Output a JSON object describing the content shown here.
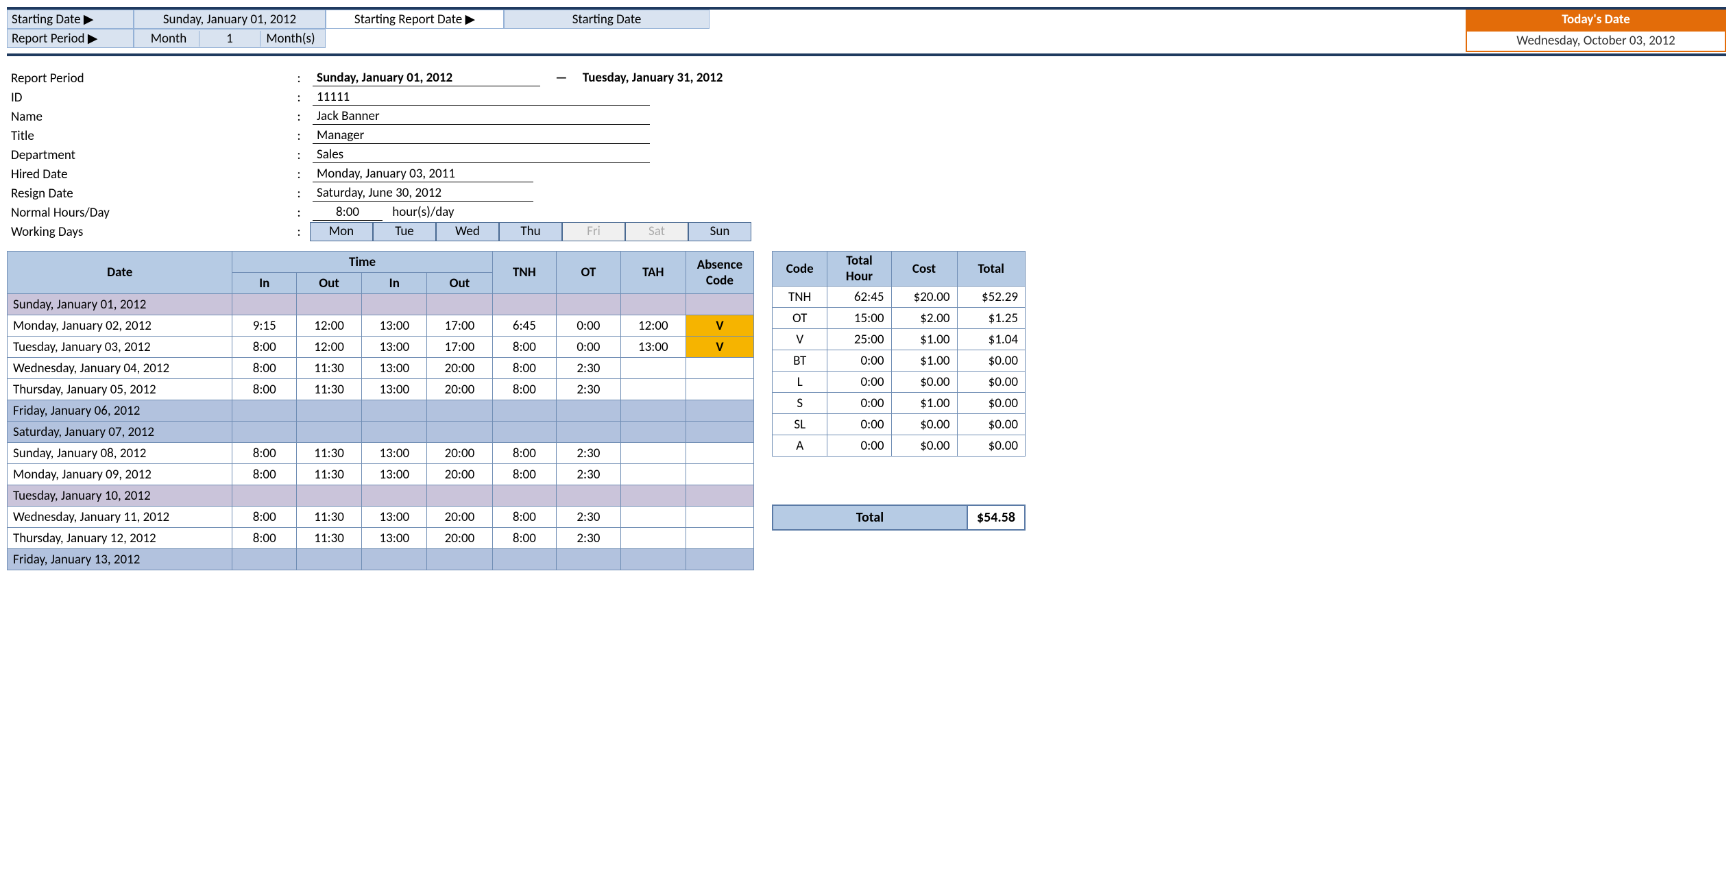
{
  "topbar": {
    "starting_date_label": "Starting Date ▶",
    "starting_date_value": "Sunday, January 01, 2012",
    "starting_report_label": "Starting Report Date ▶",
    "starting_report_value": "Starting Date",
    "report_period_label": "Report Period ▶",
    "report_period_unit": "Month",
    "report_period_num": "1",
    "report_period_suffix": "Month(s)",
    "today_label": "Today's Date",
    "today_value": "Wednesday, October 03, 2012"
  },
  "info": {
    "report_period_label": "Report Period",
    "report_period_from": "Sunday, January 01, 2012",
    "report_period_sep": "—",
    "report_period_to": "Tuesday, January 31, 2012",
    "id_label": "ID",
    "id_value": "11111",
    "name_label": "Name",
    "name_value": "Jack Banner",
    "title_label": "Title",
    "title_value": "Manager",
    "department_label": "Department",
    "department_value": "Sales",
    "hired_label": "Hired Date",
    "hired_value": "Monday, January 03, 2011",
    "resign_label": "Resign Date",
    "resign_value": "Saturday, June 30, 2012",
    "normal_label": "Normal Hours/Day",
    "normal_value": "8:00",
    "normal_suffix": "hour(s)/day",
    "working_label": "Working Days",
    "days": [
      "Mon",
      "Tue",
      "Wed",
      "Thu",
      "Fri",
      "Sat",
      "Sun"
    ],
    "days_active": [
      true,
      true,
      true,
      true,
      false,
      false,
      true
    ]
  },
  "main_headers": {
    "date": "Date",
    "time": "Time",
    "in": "In",
    "out": "Out",
    "tnh": "TNH",
    "ot": "OT",
    "tah": "TAH",
    "absence": "Absence Code"
  },
  "rows": [
    {
      "date": "Sunday, January 01, 2012",
      "in1": "",
      "out1": "",
      "in2": "",
      "out2": "",
      "tnh": "",
      "ot": "",
      "tah": "",
      "abs": "",
      "style": "lavender"
    },
    {
      "date": "Monday, January 02, 2012",
      "in1": "9:15",
      "out1": "12:00",
      "in2": "13:00",
      "out2": "17:00",
      "tnh": "6:45",
      "ot": "0:00",
      "tah": "12:00",
      "abs": "V",
      "style": "amber"
    },
    {
      "date": "Tuesday, January 03, 2012",
      "in1": "8:00",
      "out1": "12:00",
      "in2": "13:00",
      "out2": "17:00",
      "tnh": "8:00",
      "ot": "0:00",
      "tah": "13:00",
      "abs": "V",
      "style": "amber"
    },
    {
      "date": "Wednesday, January 04, 2012",
      "in1": "8:00",
      "out1": "11:30",
      "in2": "13:00",
      "out2": "20:00",
      "tnh": "8:00",
      "ot": "2:30",
      "tah": "",
      "abs": "",
      "style": ""
    },
    {
      "date": "Thursday, January 05, 2012",
      "in1": "8:00",
      "out1": "11:30",
      "in2": "13:00",
      "out2": "20:00",
      "tnh": "8:00",
      "ot": "2:30",
      "tah": "",
      "abs": "",
      "style": ""
    },
    {
      "date": "Friday, January 06, 2012",
      "in1": "",
      "out1": "",
      "in2": "",
      "out2": "",
      "tnh": "",
      "ot": "",
      "tah": "",
      "abs": "",
      "style": "blue"
    },
    {
      "date": "Saturday, January 07, 2012",
      "in1": "",
      "out1": "",
      "in2": "",
      "out2": "",
      "tnh": "",
      "ot": "",
      "tah": "",
      "abs": "",
      "style": "blue"
    },
    {
      "date": "Sunday, January 08, 2012",
      "in1": "8:00",
      "out1": "11:30",
      "in2": "13:00",
      "out2": "20:00",
      "tnh": "8:00",
      "ot": "2:30",
      "tah": "",
      "abs": "",
      "style": ""
    },
    {
      "date": "Monday, January 09, 2012",
      "in1": "8:00",
      "out1": "11:30",
      "in2": "13:00",
      "out2": "20:00",
      "tnh": "8:00",
      "ot": "2:30",
      "tah": "",
      "abs": "",
      "style": ""
    },
    {
      "date": "Tuesday, January 10, 2012",
      "in1": "",
      "out1": "",
      "in2": "",
      "out2": "",
      "tnh": "",
      "ot": "",
      "tah": "",
      "abs": "",
      "style": "lavender"
    },
    {
      "date": "Wednesday, January 11, 2012",
      "in1": "8:00",
      "out1": "11:30",
      "in2": "13:00",
      "out2": "20:00",
      "tnh": "8:00",
      "ot": "2:30",
      "tah": "",
      "abs": "",
      "style": ""
    },
    {
      "date": "Thursday, January 12, 2012",
      "in1": "8:00",
      "out1": "11:30",
      "in2": "13:00",
      "out2": "20:00",
      "tnh": "8:00",
      "ot": "2:30",
      "tah": "",
      "abs": "",
      "style": ""
    },
    {
      "date": "Friday, January 13, 2012",
      "in1": "",
      "out1": "",
      "in2": "",
      "out2": "",
      "tnh": "",
      "ot": "",
      "tah": "",
      "abs": "",
      "style": "blue"
    }
  ],
  "summary_headers": {
    "code": "Code",
    "total_hour": "Total Hour",
    "cost": "Cost",
    "total": "Total"
  },
  "summary_rows": [
    {
      "code": "TNH",
      "hour": "62:45",
      "cost": "$20.00",
      "total": "$52.29"
    },
    {
      "code": "OT",
      "hour": "15:00",
      "cost": "$2.00",
      "total": "$1.25"
    },
    {
      "code": "V",
      "hour": "25:00",
      "cost": "$1.00",
      "total": "$1.04"
    },
    {
      "code": "BT",
      "hour": "0:00",
      "cost": "$1.00",
      "total": "$0.00"
    },
    {
      "code": "L",
      "hour": "0:00",
      "cost": "$0.00",
      "total": "$0.00"
    },
    {
      "code": "S",
      "hour": "0:00",
      "cost": "$1.00",
      "total": "$0.00"
    },
    {
      "code": "SL",
      "hour": "0:00",
      "cost": "$0.00",
      "total": "$0.00"
    },
    {
      "code": "A",
      "hour": "0:00",
      "cost": "$0.00",
      "total": "$0.00"
    }
  ],
  "grand_total": {
    "label": "Total",
    "value": "$54.58"
  }
}
